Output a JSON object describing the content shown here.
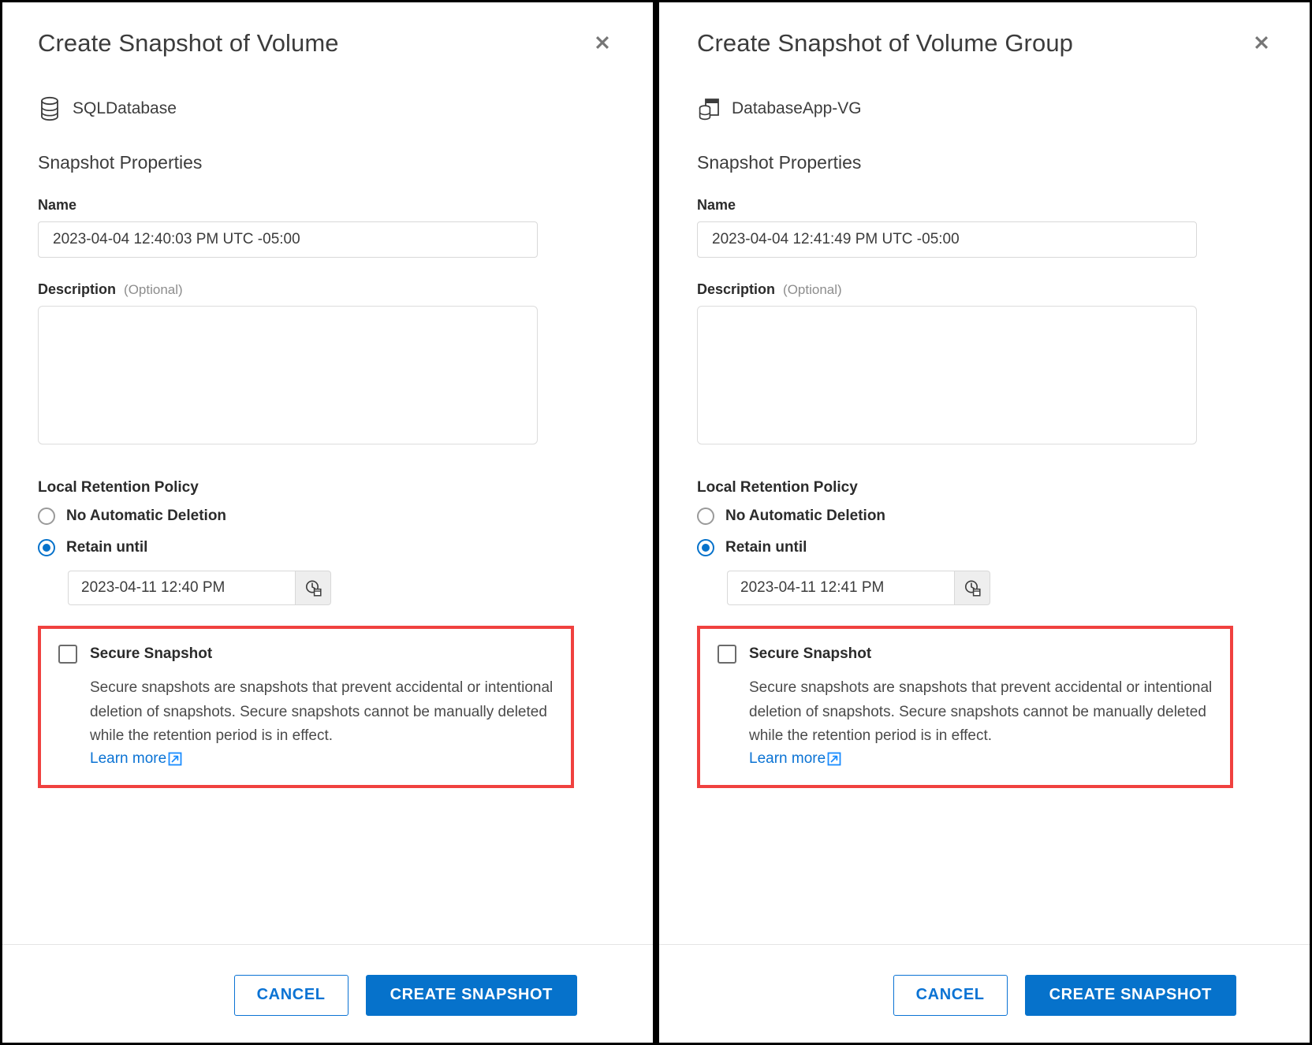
{
  "panels": [
    {
      "title": "Create Snapshot of Volume",
      "close_label": "✖",
      "object_icon": "volume-icon",
      "object_name": "SQLDatabase",
      "section_title": "Snapshot Properties",
      "name_label": "Name",
      "name_value": "2023-04-04 12:40:03 PM UTC -05:00",
      "description_label": "Description",
      "description_optional": "(Optional)",
      "description_value": "",
      "retention_group_label": "Local Retention Policy",
      "radio_no_auto": "No Automatic Deletion",
      "radio_retain": "Retain until",
      "retain_date": "2023-04-11 12:40 PM",
      "date_picker_icon": "clock-calendar-icon",
      "secure_title": "Secure Snapshot",
      "secure_desc": "Secure snapshots are snapshots that prevent accidental or intentional deletion of snapshots. Secure snapshots cannot be manually deleted while the retention period is in effect.",
      "learn_more": "Learn more",
      "learn_more_icon": "external-link-icon",
      "cancel_label": "CANCEL",
      "create_label": "CREATE SNAPSHOT"
    },
    {
      "title": "Create Snapshot of Volume Group",
      "close_label": "✖",
      "object_icon": "volume-group-icon",
      "object_name": "DatabaseApp-VG",
      "section_title": "Snapshot Properties",
      "name_label": "Name",
      "name_value": "2023-04-04 12:41:49 PM UTC -05:00",
      "description_label": "Description",
      "description_optional": "(Optional)",
      "description_value": "",
      "retention_group_label": "Local Retention Policy",
      "radio_no_auto": "No Automatic Deletion",
      "radio_retain": "Retain until",
      "retain_date": "2023-04-11 12:41 PM",
      "date_picker_icon": "clock-calendar-icon",
      "secure_title": "Secure Snapshot",
      "secure_desc": "Secure snapshots are snapshots that prevent accidental or intentional deletion of snapshots. Secure snapshots cannot be manually deleted while the retention period is in effect.",
      "learn_more": "Learn more",
      "learn_more_icon": "external-link-icon",
      "cancel_label": "CANCEL",
      "create_label": "CREATE SNAPSHOT"
    }
  ],
  "state": {
    "retention_selected": "retain_until",
    "secure_snapshot_checked": false
  },
  "colors": {
    "accent": "#0672cb",
    "link": "#0b73d4",
    "highlight": "#f0413f",
    "text": "#2b2b2b",
    "muted": "#8d8d8d"
  }
}
